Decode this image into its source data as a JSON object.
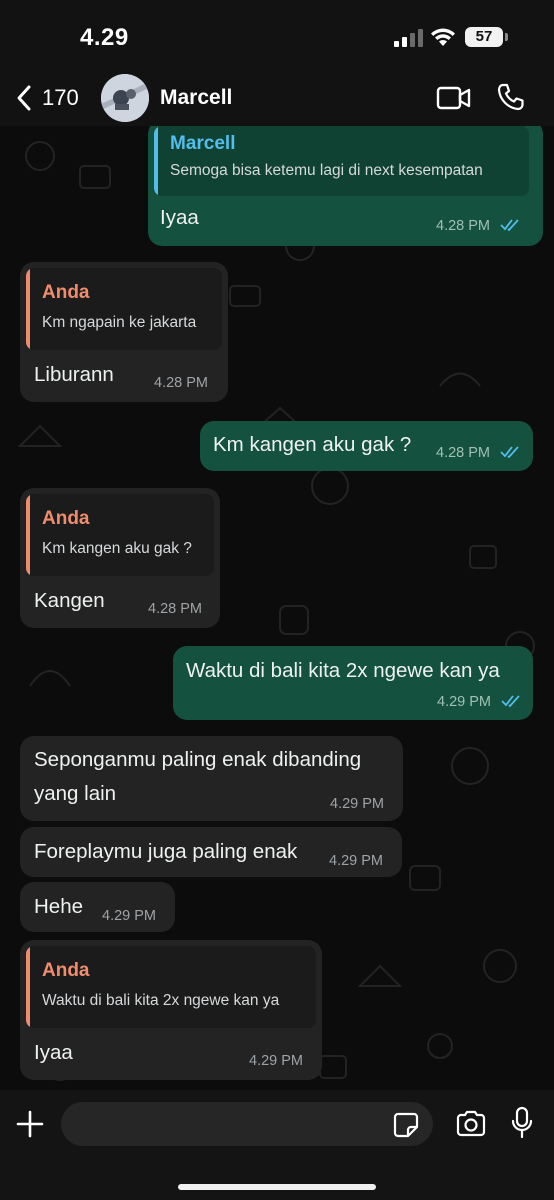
{
  "status_bar": {
    "time": "4.29",
    "battery": "57"
  },
  "header": {
    "back_count": "170",
    "contact_name": "Marcell"
  },
  "colors": {
    "incoming_bubble": "#232323",
    "outgoing_bubble": "#14513f",
    "quote_marcell": "#53bdeb",
    "quote_anda": "#f08c6e",
    "read_ticks": "#53bdeb"
  },
  "messages": [
    {
      "direction": "outgoing",
      "quote": {
        "author": "Marcell",
        "text": "Semoga bisa ketemu lagi di next kesempatan"
      },
      "text": "Iyaa",
      "time": "4.28 PM",
      "status": "read"
    },
    {
      "direction": "incoming",
      "quote": {
        "author": "Anda",
        "text": "Km ngapain ke jakarta"
      },
      "text": "Liburann",
      "time": "4.28 PM"
    },
    {
      "direction": "outgoing",
      "text": "Km kangen aku gak ?",
      "time": "4.28 PM",
      "status": "read"
    },
    {
      "direction": "incoming",
      "quote": {
        "author": "Anda",
        "text": "Km kangen aku gak ?"
      },
      "text": "Kangen",
      "time": "4.28 PM"
    },
    {
      "direction": "outgoing",
      "text": "Waktu di bali kita 2x ngewe kan ya",
      "time": "4.29 PM",
      "status": "read"
    },
    {
      "direction": "incoming",
      "text_lines": [
        "Seponganmu paling enak dibanding",
        "yang lain"
      ],
      "time": "4.29 PM"
    },
    {
      "direction": "incoming",
      "text": "Foreplaymu juga paling enak",
      "time": "4.29 PM"
    },
    {
      "direction": "incoming",
      "text": "Hehe",
      "time": "4.29 PM"
    },
    {
      "direction": "incoming",
      "quote": {
        "author": "Anda",
        "text": "Waktu di bali kita 2x ngewe kan ya"
      },
      "text": "Iyaa",
      "time": "4.29 PM"
    }
  ],
  "input_bar": {
    "placeholder": ""
  },
  "icons": [
    "back-chevron-icon",
    "video-call-icon",
    "phone-icon",
    "plus-icon",
    "sticker-icon",
    "camera-icon",
    "microphone-icon",
    "read-receipt-icon"
  ]
}
